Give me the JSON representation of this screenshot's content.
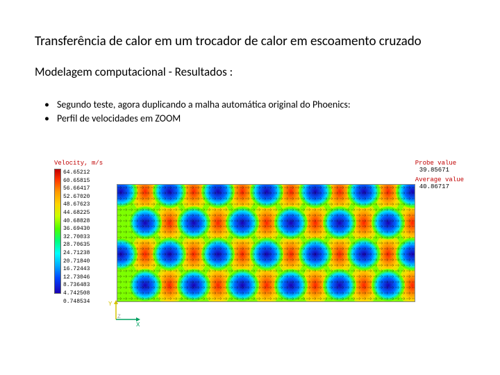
{
  "title": "Transferência de calor em um trocador de calor em escoamento cruzado",
  "subtitle": "Modelagem computacional - Resultados :",
  "bullets": [
    "Segundo teste, agora duplicando a malha automática original do Phoenics:",
    "Perfil de velocidades em ZOOM"
  ],
  "legend": {
    "title": "Velocity, m/s",
    "values": [
      "64.65212",
      "60.65815",
      "56.66417",
      "52.67020",
      "48.67623",
      "44.68225",
      "40.68828",
      "36.69430",
      "32.70033",
      "28.70635",
      "24.71238",
      "20.71840",
      "16.72443",
      "12.73046",
      "8.736483",
      "4.742508",
      "0.748534"
    ]
  },
  "probe": {
    "probe_label": "Probe value",
    "probe_value": "39.85671",
    "avg_label": "Average value",
    "avg_value": "40.86717"
  },
  "axis": {
    "y": "Y",
    "x": "X",
    "z": "Z"
  }
}
